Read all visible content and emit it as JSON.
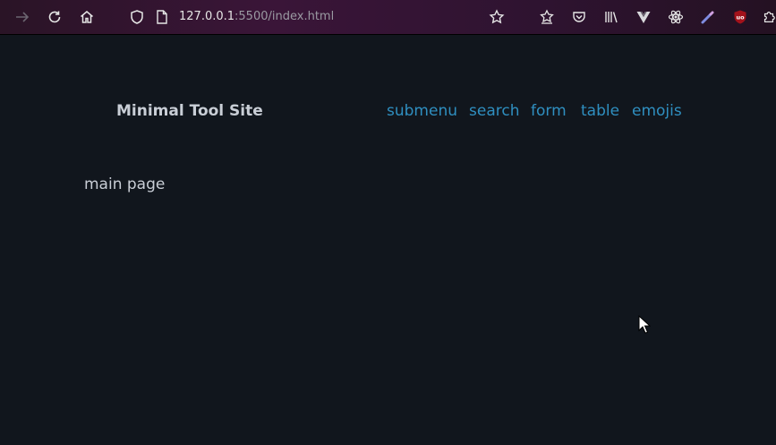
{
  "browser": {
    "url_host": "127.0.0.1",
    "url_rest": ":5500/index.html",
    "icons": [
      "forward-icon",
      "reload-icon",
      "home-icon",
      "shield-icon",
      "page-icon",
      "bookmark-star-icon",
      "extension-1-icon",
      "pocket-icon",
      "library-icon",
      "vue-devtools-icon",
      "react-devtools-icon",
      "color-picker-icon",
      "ublock-icon",
      "extensions-icon"
    ],
    "ublock_badge": "uo"
  },
  "site": {
    "title": "Minimal Tool Site",
    "nav": [
      "submenu",
      "search",
      "form",
      "table",
      "emojis"
    ]
  },
  "main": {
    "text": "main page"
  },
  "colors": {
    "background": "#11161d",
    "link": "#2f8fc0",
    "text": "#c9ced6"
  }
}
